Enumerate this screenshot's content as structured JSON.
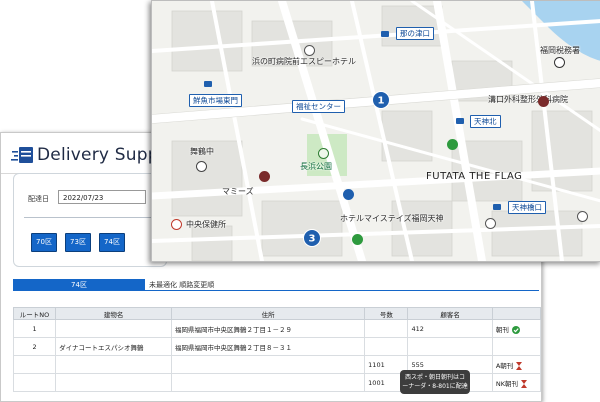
{
  "app": {
    "title": "Delivery Support",
    "date_label": "配達日",
    "date_value": "2022/07/23",
    "route_buttons": [
      "70区",
      "73区",
      "74区"
    ],
    "active_tab": "74区",
    "tab_note": "未最適化 順路変更順",
    "table": {
      "headers": [
        "ルートNO",
        "建物名",
        "住所",
        "号数",
        "顧客名",
        ""
      ],
      "rows": [
        {
          "no": "1",
          "building": "",
          "address": "福岡県福岡市中央区舞鶴２丁目１－２９",
          "unit": "",
          "customer": "412",
          "item": "朝刊",
          "status": "check"
        },
        {
          "no": "2",
          "building": "ダイナコートエスパシオ舞鶴",
          "address": "福岡県福岡市中央区舞鶴２丁目８－３１",
          "unit": "",
          "customer": "",
          "item": "",
          "status": ""
        },
        {
          "no": "",
          "building": "",
          "address": "",
          "unit": "1101",
          "customer": "555",
          "item": "A朝刊",
          "status": "hourglass"
        },
        {
          "no": "",
          "building": "",
          "address": "",
          "unit": "1001",
          "customer": "556",
          "item": "NK朝刊",
          "status": "hourglass"
        }
      ]
    },
    "tooltip_line1": "西スポ・朝日朝刊はコ",
    "tooltip_line2": "ーナーダ・8-801に配達"
  },
  "map": {
    "labels": {
      "hospital_hotel": "浜の町病院前エスピーホテル",
      "tax_office": "福岡税務署",
      "mizoguchi": "溝口外科整形外科病院",
      "maizuru_jhs": "舞鶴中",
      "nagahama_park": "長浜公園",
      "mamies": "マミーズ",
      "futata": "FUTATA THE FLAG",
      "hotel_my_stays": "ホテルマイステイズ福岡天神",
      "health_center": "中央保健所"
    },
    "stops": {
      "nanotsu": "那の津口",
      "fishmarket": "鮮魚市場東門",
      "welfare": "福祉センター",
      "tenjin_north": "天神北",
      "tenjin_bridge": "天神橋口"
    },
    "pins": [
      "1",
      "3"
    ]
  },
  "colors": {
    "accent": "#1466c8",
    "map_bg": "#f2f2ee",
    "water": "#a8d3f0",
    "park": "#cde9c4"
  }
}
